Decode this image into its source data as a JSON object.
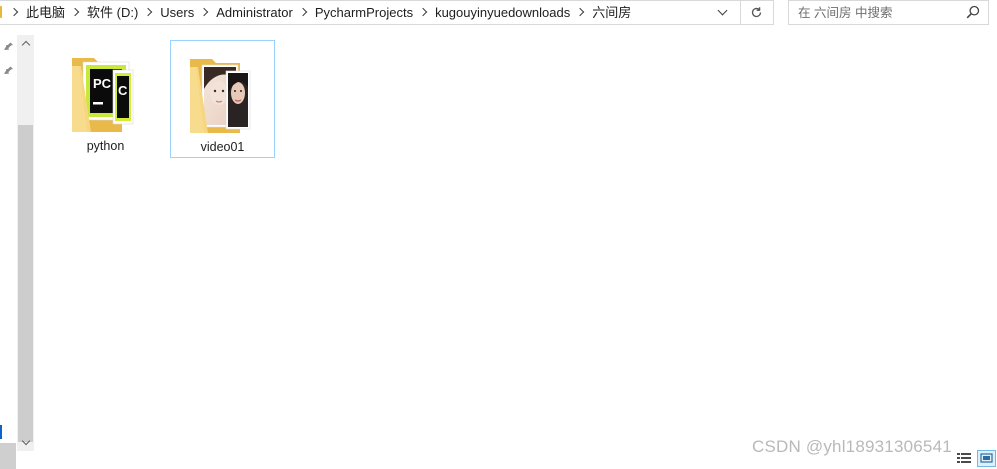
{
  "address_bar": {
    "breadcrumbs": [
      "此电脑",
      "软件 (D:)",
      "Users",
      "Administrator",
      "PycharmProjects",
      "kugouyinyuedownloads",
      "六间房"
    ]
  },
  "search": {
    "placeholder": "在 六间房 中搜索"
  },
  "files": [
    {
      "name": "python",
      "type": "folder",
      "preview": "pycharm-icon"
    },
    {
      "name": "video01",
      "type": "folder",
      "preview": "photo",
      "selected": true
    }
  ],
  "watermark": "CSDN @yhl18931306541",
  "colors": {
    "folder": "#f5d27a",
    "selection_border": "#99d1ff",
    "pycharm_green": "#21d789",
    "pycharm_yellow": "#fcf84a"
  }
}
